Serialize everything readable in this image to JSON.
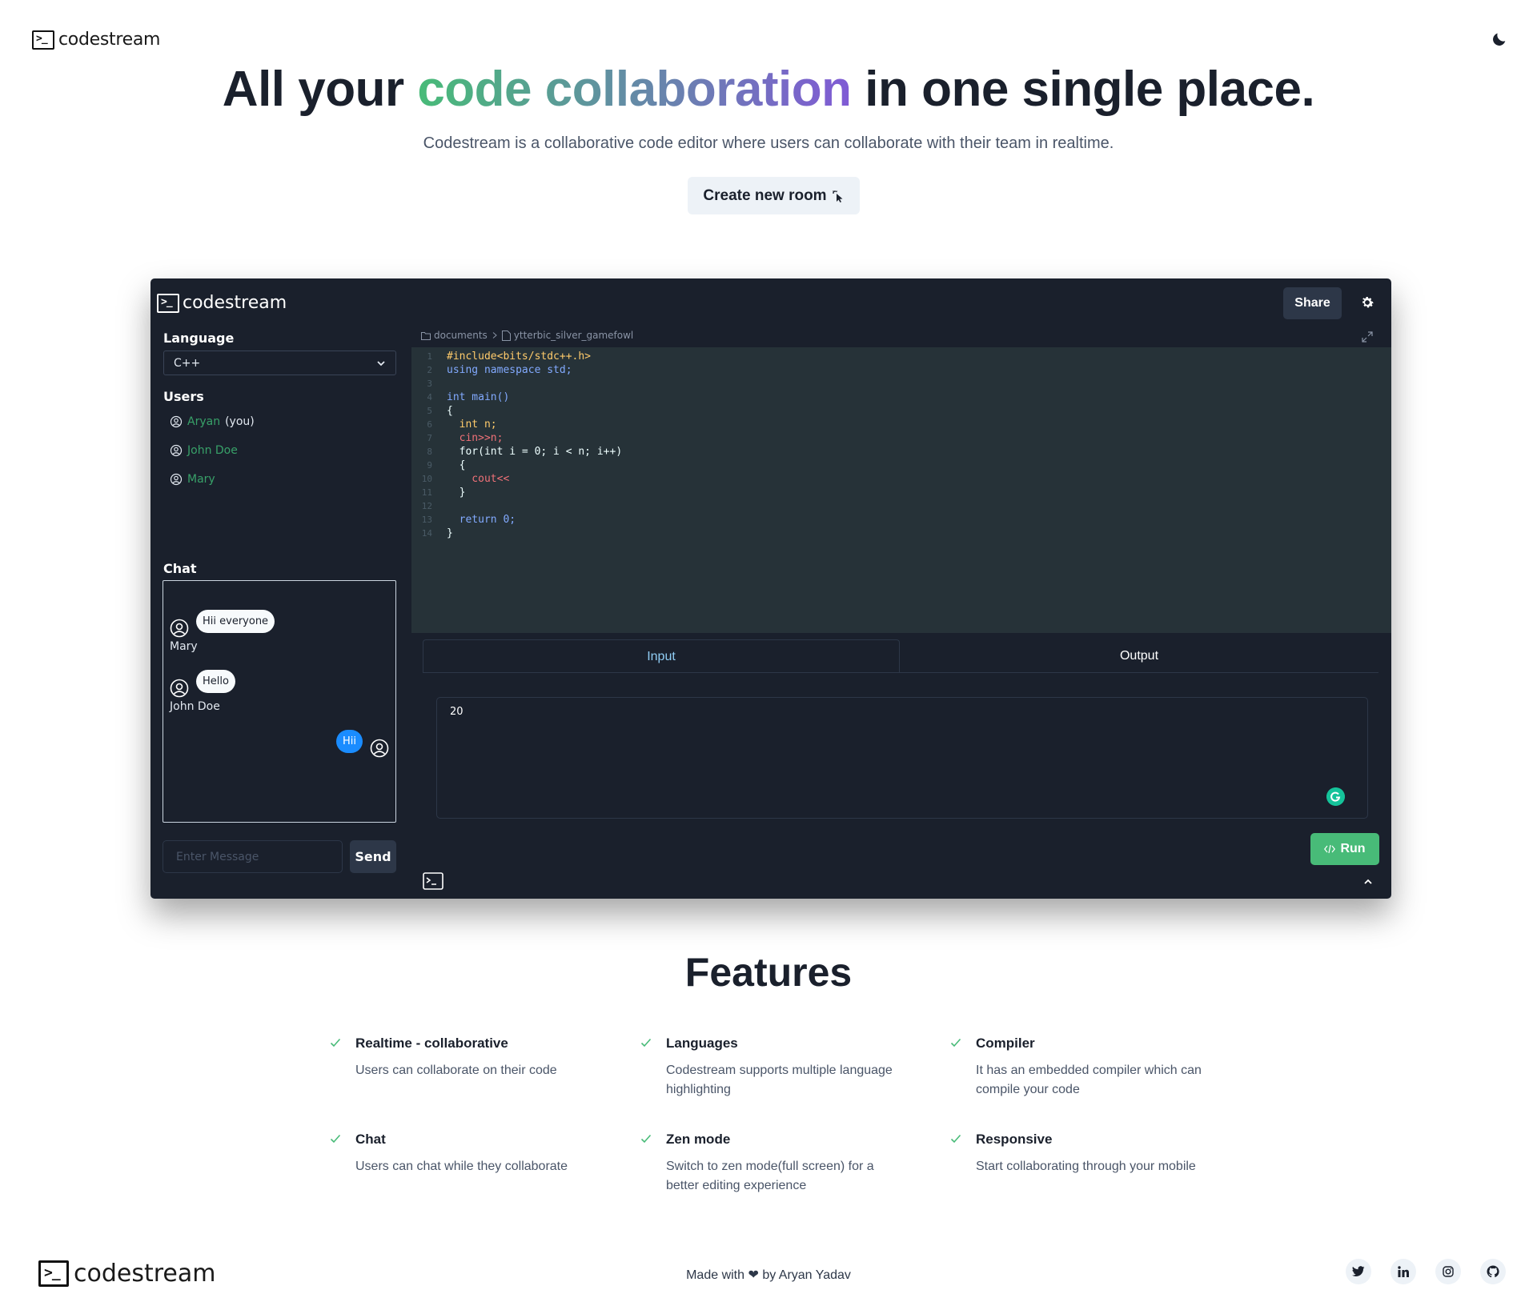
{
  "nav": {
    "brand": "codestream",
    "logo_prompt": ">_",
    "theme_icon": "moon-icon"
  },
  "hero": {
    "title_part1": "All your ",
    "title_highlight": "code collaboration",
    "title_part2": " in one single place.",
    "subtitle": "Codestream is a collaborative code editor where users can collaborate with their team in realtime.",
    "cta_label": "Create new room",
    "cta_icon": "pointer-click-icon",
    "gradient": [
      "#48bb78",
      "#805ad5"
    ]
  },
  "app": {
    "brand": "codestream",
    "share_label": "Share",
    "settings_icon": "gear-icon",
    "language_label": "Language",
    "language_value": "C++",
    "users_label": "Users",
    "users": [
      {
        "name": "Aryan",
        "suffix": "(you)"
      },
      {
        "name": "John Doe",
        "suffix": ""
      },
      {
        "name": "Mary",
        "suffix": ""
      }
    ],
    "chat_label": "Chat",
    "messages": [
      {
        "author": "Mary",
        "text": "Hii everyone"
      },
      {
        "author": "John Doe",
        "text": "Hello"
      },
      {
        "author": "",
        "text": "Hii"
      }
    ],
    "message_placeholder": "Enter Message",
    "send_label": "Send",
    "breadcrumb": [
      "documents",
      "ytterbic_silver_gamefowl"
    ],
    "code_lines": [
      "#include<bits/stdc++.h>",
      "using namespace std;",
      "",
      "int main()",
      "{",
      "  int n;",
      "  cin>>n;",
      "  for(int i = 0; i < n; i++)",
      "  {",
      "    cout<<",
      "  }",
      "",
      "  return 0;",
      "}"
    ],
    "tabs": [
      "Input",
      "Output"
    ],
    "input_value": "20",
    "run_label": "Run",
    "accent": "#48bb78"
  },
  "features": {
    "title": "Features",
    "items": [
      {
        "title": "Realtime - collaborative",
        "desc": "Users can collaborate on their code"
      },
      {
        "title": "Languages",
        "desc": "Codestream supports multiple language highlighting"
      },
      {
        "title": "Compiler",
        "desc": "It has an embedded compiler which can compile your code"
      },
      {
        "title": "Chat",
        "desc": "Users can chat while they collaborate"
      },
      {
        "title": "Zen mode",
        "desc": "Switch to zen mode(full screen) for a better editing experience"
      },
      {
        "title": "Responsive",
        "desc": "Start collaborating through your mobile"
      }
    ]
  },
  "footer": {
    "brand": "codestream",
    "made_with": "Made with ❤ by Aryan Yadav",
    "socials": [
      "twitter-icon",
      "linkedin-icon",
      "instagram-icon",
      "github-icon"
    ]
  }
}
